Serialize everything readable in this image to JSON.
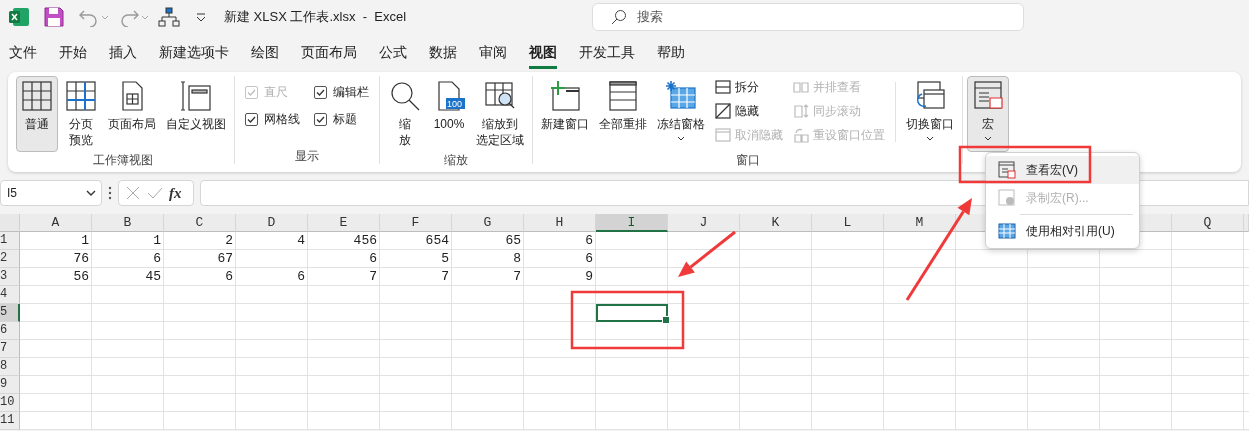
{
  "title_bar": {
    "title": "新建 XLSX 工作表.xlsx  -  Excel",
    "search": {
      "placeholder": "搜索"
    }
  },
  "menu_tabs": [
    {
      "label": "文件",
      "selected": false
    },
    {
      "label": "开始",
      "selected": false
    },
    {
      "label": "插入",
      "selected": false
    },
    {
      "label": "新建选项卡",
      "selected": false
    },
    {
      "label": "绘图",
      "selected": false
    },
    {
      "label": "页面布局",
      "selected": false
    },
    {
      "label": "公式",
      "selected": false
    },
    {
      "label": "数据",
      "selected": false
    },
    {
      "label": "审阅",
      "selected": false
    },
    {
      "label": "视图",
      "selected": true
    },
    {
      "label": "开发工具",
      "selected": false
    },
    {
      "label": "帮助",
      "selected": false
    }
  ],
  "ribbon": {
    "groups": [
      {
        "label": "工作簿视图",
        "items": [
          {
            "kind": "large",
            "label": "普通",
            "selected": true
          },
          {
            "kind": "large",
            "label": "分页预览",
            "wrap": true,
            "selected": false
          },
          {
            "kind": "large",
            "label": "页面布局",
            "selected": false
          },
          {
            "kind": "large",
            "label": "自定义视图",
            "selected": false
          }
        ]
      },
      {
        "label": "显示",
        "items": [
          {
            "kind": "checks",
            "items": [
              {
                "label": "直尺",
                "checked": true,
                "disabled": true
              },
              {
                "label": "编辑栏",
                "checked": true,
                "disabled": false
              },
              {
                "label": "网格线",
                "checked": true,
                "disabled": false
              },
              {
                "label": "标题",
                "checked": true,
                "disabled": false
              }
            ]
          }
        ]
      },
      {
        "label": "缩放",
        "items": [
          {
            "kind": "large",
            "label": "缩放",
            "wrap": true,
            "selected": false
          },
          {
            "kind": "large",
            "label": "100%",
            "badge": "100",
            "selected": false
          },
          {
            "kind": "large",
            "label": "缩放到选定区域",
            "wrap": true,
            "selected": false
          }
        ]
      },
      {
        "label": "窗口",
        "items": [
          {
            "kind": "large",
            "label": "新建窗口",
            "selected": false
          },
          {
            "kind": "large",
            "label": "全部重排",
            "selected": false
          },
          {
            "kind": "large",
            "label": "冻结窗格",
            "dropdown": true,
            "selected": false
          },
          {
            "kind": "stack",
            "items": [
              {
                "label": "拆分",
                "disabled": false
              },
              {
                "label": "隐藏",
                "disabled": false
              },
              {
                "label": "取消隐藏",
                "disabled": true
              }
            ]
          },
          {
            "kind": "stack",
            "items": [
              {
                "label": "并排查看",
                "disabled": true
              },
              {
                "label": "同步滚动",
                "disabled": true
              },
              {
                "label": "重设窗口位置",
                "disabled": true
              }
            ]
          },
          {
            "kind": "separator"
          },
          {
            "kind": "large",
            "label": "切换窗口",
            "dropdown": true,
            "selected": false
          }
        ]
      },
      {
        "items": [
          {
            "kind": "large",
            "label": "宏",
            "dropdown": true,
            "selected": true
          }
        ]
      }
    ]
  },
  "formula_bar": {
    "name_box": {
      "value": "I5"
    },
    "function_label": "fx"
  },
  "sheet": {
    "columns": [
      {
        "label": "A",
        "selected": false
      },
      {
        "label": "B",
        "selected": false
      },
      {
        "label": "C",
        "selected": false
      },
      {
        "label": "D",
        "selected": false
      },
      {
        "label": "E",
        "selected": false
      },
      {
        "label": "F",
        "selected": false
      },
      {
        "label": "G",
        "selected": false
      },
      {
        "label": "H",
        "selected": false
      },
      {
        "label": "I",
        "selected": true
      },
      {
        "label": "J",
        "selected": false
      },
      {
        "label": "K",
        "selected": false
      },
      {
        "label": "L",
        "selected": false
      },
      {
        "label": "M",
        "selected": false
      },
      {},
      {},
      {},
      {
        "label": "Q",
        "selected": false
      }
    ],
    "rows": [
      {
        "label": "1",
        "selected": false,
        "cells": [
          "1",
          "1",
          "2",
          "4",
          "456",
          "654",
          "65",
          "6"
        ]
      },
      {
        "label": "2",
        "selected": false,
        "cells": [
          "76",
          "6",
          "67",
          null,
          "6",
          "5",
          "8",
          "6"
        ]
      },
      {
        "label": "3",
        "selected": false,
        "cells": [
          "56",
          "45",
          "6",
          "6",
          "7",
          "7",
          "7",
          "9"
        ]
      },
      {
        "label": "4",
        "selected": false
      },
      {
        "label": "5",
        "selected": true
      },
      {
        "label": "6",
        "selected": false
      },
      {
        "label": "7",
        "selected": false
      },
      {
        "label": "8",
        "selected": false
      },
      {
        "label": "9",
        "selected": false
      },
      {
        "label": "10",
        "selected": false
      },
      {
        "label": "11",
        "selected": false
      }
    ]
  },
  "dropdown_menu": {
    "items": [
      {
        "kind": "item",
        "label": "查看宏(V)",
        "hovered": true,
        "disabled": false
      },
      {
        "kind": "item",
        "label": "录制宏(R)...",
        "hovered": false,
        "disabled": true
      },
      {
        "kind": "separator"
      },
      {
        "kind": "item",
        "label": "使用相对引用(U)",
        "hovered": false,
        "disabled": false
      }
    ]
  },
  "annotations": [
    {
      "kind": "box"
    },
    {
      "kind": "box"
    },
    {
      "kind": "arrow"
    },
    {
      "kind": "arrow"
    }
  ]
}
